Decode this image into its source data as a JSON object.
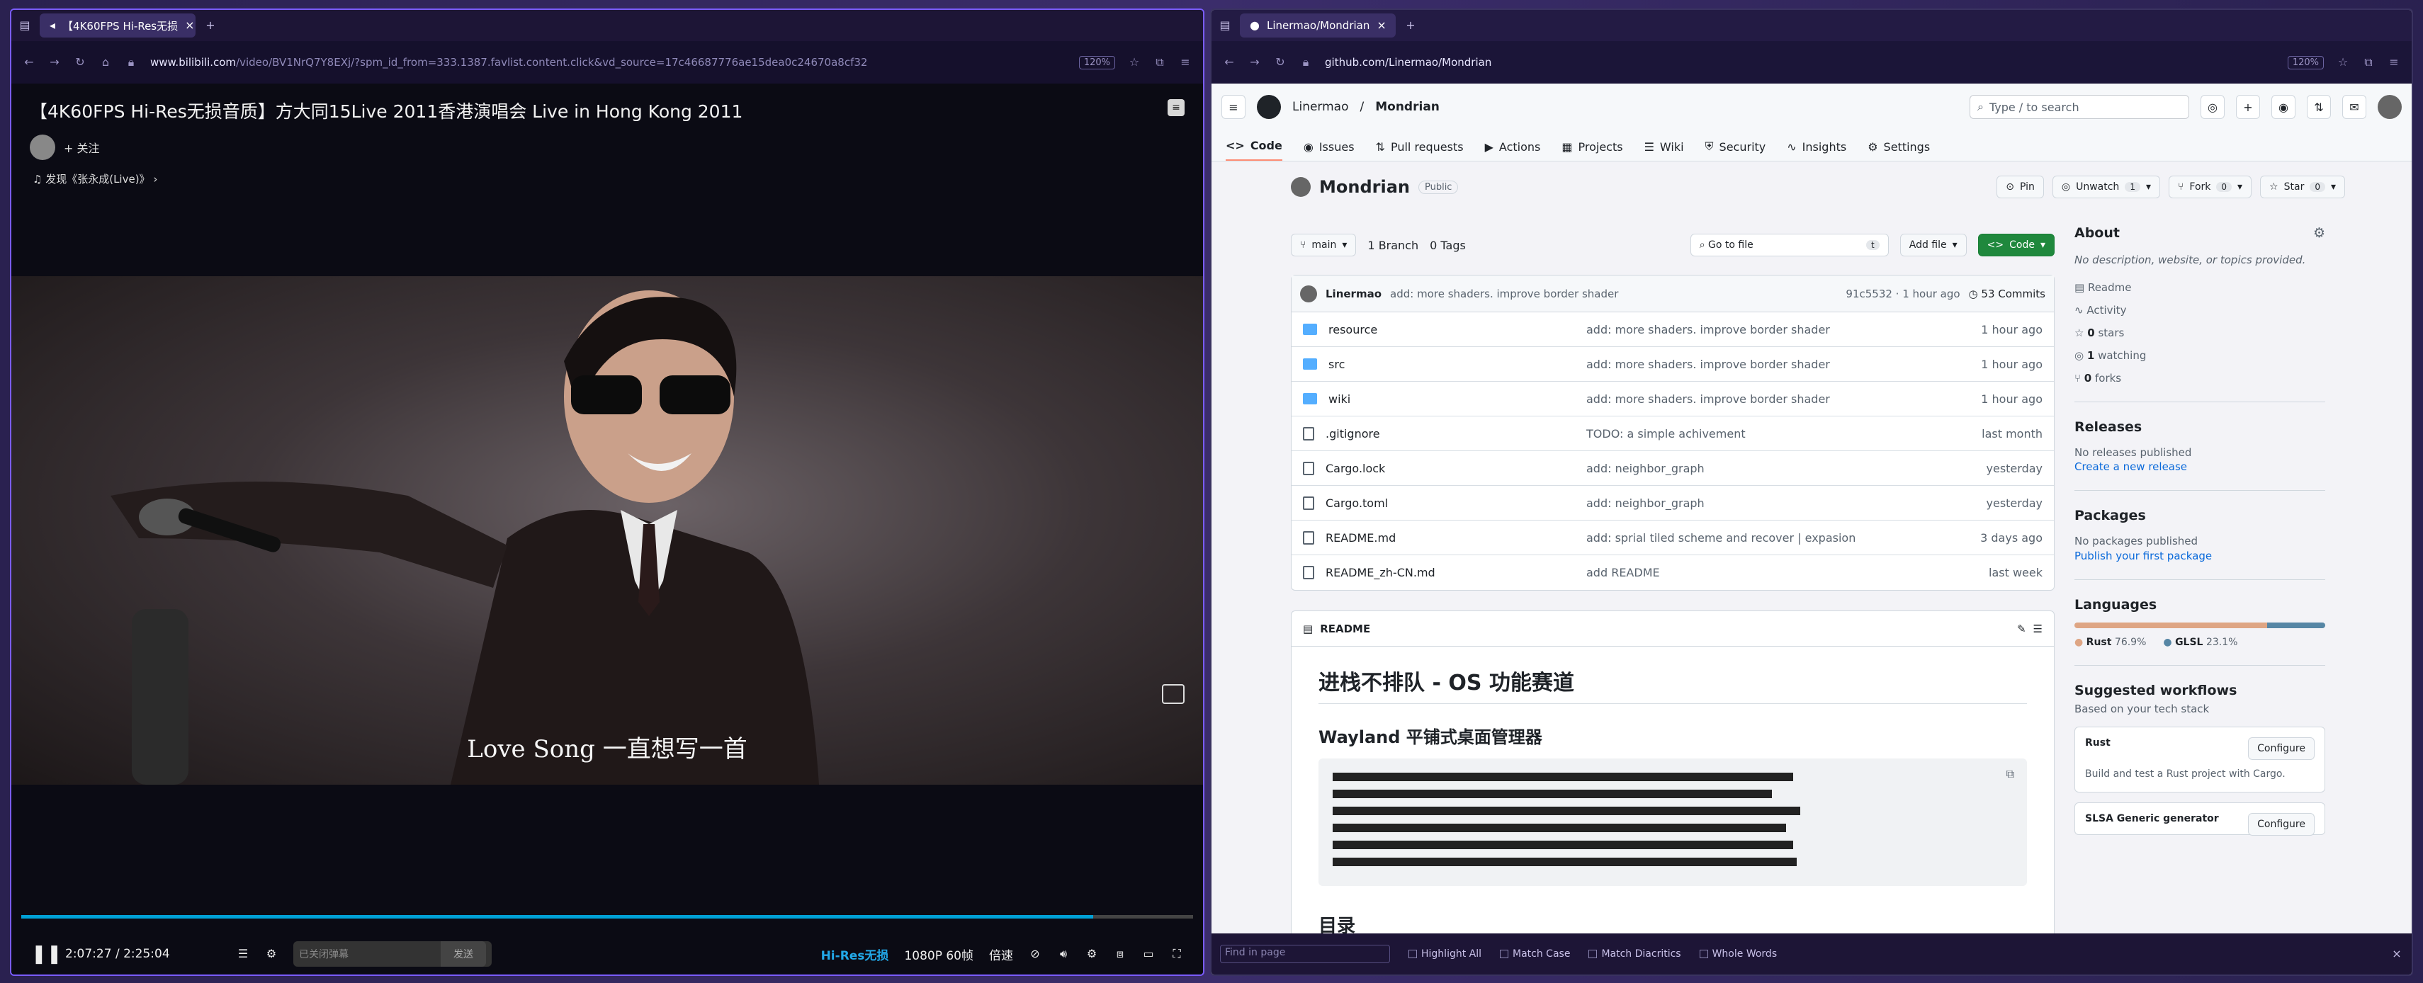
{
  "left": {
    "tab_title": "【4K60FPS Hi-Res无损",
    "url_host": "www.bilibili.com",
    "url_rest": "/video/BV1NrQ7Y8EXj/?spm_id_from=333.1387.favlist.content.click&vd_source=17c46687776ae15dea0c24670a8cf32",
    "zoom": "120%",
    "video_title": "【4K60FPS Hi-Res无损音质】方大同15Live 2011香港演唱会 Live in Hong Kong 2011",
    "follow_label": "+ 关注",
    "music_label": "发现《张永成(Live)》",
    "subtitle": "Love Song 一直想写一首",
    "progress": 0.915,
    "time_current": "2:07:27",
    "time_sep": "/",
    "time_total": "2:25:04",
    "danmaku_placeholder": "已关闭弹幕",
    "danmaku_send": "发送",
    "hires_label": "Hi-Res无损",
    "quality_label": "1080P 60帧",
    "speed_label": "倍速"
  },
  "right": {
    "tab_title": "Linermao/Mondrian",
    "url": "github.com/Linermao/Mondrian",
    "zoom": "120%",
    "owner": "Linermao",
    "sep": "/",
    "repo": "Mondrian",
    "search_placeholder": "Type / to search",
    "nav": [
      "Code",
      "Issues",
      "Pull requests",
      "Actions",
      "Projects",
      "Wiki",
      "Security",
      "Insights",
      "Settings"
    ],
    "visibility": "Public",
    "pin": "Pin",
    "unwatch": "Unwatch",
    "unwatch_count": "1",
    "fork": "Fork",
    "fork_count": "0",
    "star": "Star",
    "star_count": "0",
    "branch": "main",
    "branches": "1 Branch",
    "tags": "0 Tags",
    "goto_file": "Go to file",
    "goto_key": "t",
    "add_file": "Add file",
    "code_btn": "Code",
    "commit": {
      "author": "Linermao",
      "message": "add: more shaders. improve border shader",
      "hash_time": "91c5532 · 1 hour ago",
      "commits": "53 Commits"
    },
    "files": [
      {
        "name": "resource",
        "type": "dir",
        "msg": "add: more shaders. improve border shader",
        "age": "1 hour ago"
      },
      {
        "name": "src",
        "type": "dir",
        "msg": "add: more shaders. improve border shader",
        "age": "1 hour ago"
      },
      {
        "name": "wiki",
        "type": "dir",
        "msg": "add: more shaders. improve border shader",
        "age": "1 hour ago"
      },
      {
        "name": ".gitignore",
        "type": "file",
        "msg": "TODO: a simple achivement",
        "age": "last month"
      },
      {
        "name": "Cargo.lock",
        "type": "file",
        "msg": "add: neighbor_graph",
        "age": "yesterday"
      },
      {
        "name": "Cargo.toml",
        "type": "file",
        "msg": "add: neighbor_graph",
        "age": "yesterday"
      },
      {
        "name": "README.md",
        "type": "file",
        "msg": "add: sprial tiled scheme and recover | expasion",
        "age": "3 days ago"
      },
      {
        "name": "README_zh-CN.md",
        "type": "file",
        "msg": "add README",
        "age": "last week"
      }
    ],
    "readme_label": "README",
    "readme_h1": "进栈不排队 - OS 功能赛道",
    "readme_h2": "Wayland 平铺式桌面管理器",
    "readme_h3": "目录",
    "about": {
      "title": "About",
      "desc": "No description, website, or topics provided.",
      "readme": "Readme",
      "activity": "Activity",
      "stars_n": "0",
      "stars": "stars",
      "watching_n": "1",
      "watching": "watching",
      "forks_n": "0",
      "forks": "forks"
    },
    "releases": {
      "title": "Releases",
      "none": "No releases published",
      "link": "Create a new release"
    },
    "packages": {
      "title": "Packages",
      "none": "No packages published",
      "link": "Publish your first package"
    },
    "languages": {
      "title": "Languages",
      "items": [
        {
          "name": "Rust",
          "pct": "76.9%",
          "value": 76.9,
          "color": "#dea584"
        },
        {
          "name": "GLSL",
          "pct": "23.1%",
          "value": 23.1,
          "color": "#5686a5"
        }
      ]
    },
    "workflows": {
      "title": "Suggested workflows",
      "sub": "Based on your tech stack",
      "rust_title": "Rust",
      "rust_desc": "Build and test a Rust project with Cargo.",
      "slsa_title": "SLSA Generic generator",
      "configure": "Configure"
    },
    "find": {
      "placeholder": "Find in page",
      "highlight": "Highlight All",
      "case": "Match Case",
      "diacritics": "Match Diacritics",
      "whole": "Whole Words"
    }
  }
}
